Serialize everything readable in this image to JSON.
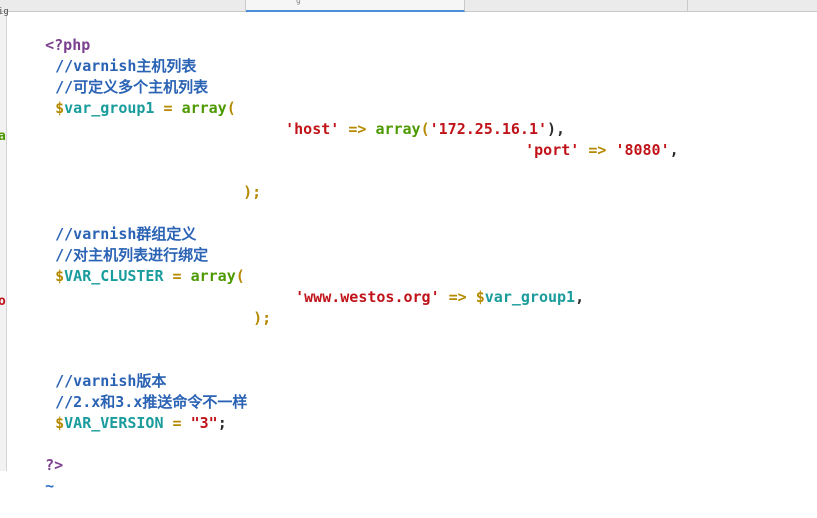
{
  "tabs": [
    {
      "label": "",
      "active": false
    },
    {
      "label": "g",
      "active": true
    },
    {
      "label": "",
      "active": false
    },
    {
      "label": "",
      "active": false
    }
  ],
  "gutter_marks": [
    "ig",
    "a",
    "o"
  ],
  "code": {
    "php_open": "<?php",
    "comment_hosts": "//varnish主机列表",
    "comment_multi": "//可定义多个主机列表",
    "var_group": "var_group1",
    "dollar": "$",
    "assign": "=",
    "array_kw": "array",
    "paren_open": "(",
    "paren_close_semi": ");",
    "comma": ",",
    "arrow": "=>",
    "quote": "'",
    "dquote": "\"",
    "semicolon": ";",
    "host_key": "host",
    "host_ip": "172.25.16.1",
    "host_close": "),",
    "port_key": "port",
    "port_val": "8080",
    "comment_cluster": "//varnish群组定义",
    "comment_bind": "//对主机列表进行绑定",
    "var_cluster": "VAR_CLUSTER",
    "site_key": "www.westos.org",
    "comment_version": "//varnish版本",
    "comment_version_cmd": "//2.x和3.x推送命令不一样",
    "var_version": "VAR_VERSION",
    "version_val": "3",
    "php_close": "?>",
    "tilde": "~"
  }
}
